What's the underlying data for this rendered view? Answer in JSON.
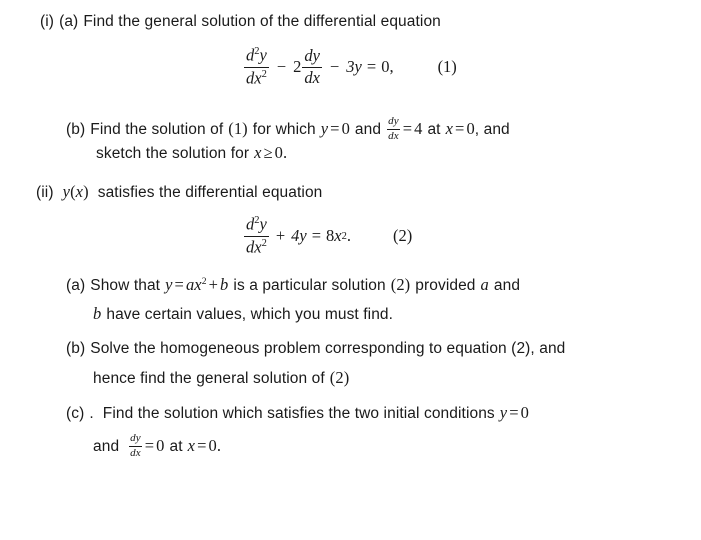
{
  "document": {
    "type": "math-exam-question",
    "background_color": "#ffffff",
    "text_color": "#1a1a1a",
    "topic": "differential equations"
  },
  "parts": {
    "i": {
      "label": "(i)",
      "a": {
        "label": "(a)",
        "text": "Find the general solution of the differential equation"
      },
      "equation1": {
        "number": "(1)",
        "numerator": "d",
        "numerator_exp": "2",
        "numerator_var": "y",
        "denominator": "dx",
        "denominator_exp": "2",
        "minus": "−",
        "coefficient": "2",
        "dy": "dy",
        "dx": "dx",
        "minus2": "−",
        "term": "3y",
        "equals": "=",
        "rhs": "0,",
        "plain": "d²y/dx² − 2 dy/dx − 3y = 0,"
      },
      "b": {
        "label": "(b)",
        "line1_pre": "Find the solution of",
        "line1_ref": "(1)",
        "line1_mid": "for which",
        "line1_y": "y",
        "line1_eq": "=",
        "line1_zero": "0",
        "line1_and": "and",
        "line1_dy": "dy",
        "line1_dx": "dx",
        "line1_eq2": "=",
        "line1_four": "4",
        "line1_at": "at",
        "line1_x": "x",
        "line1_eq3": "=",
        "line1_zero2": "0",
        "line1_tail": ", and",
        "line2_pre": "sketch the solution for",
        "line2_x": "x",
        "line2_ge": "≥",
        "line2_zero": "0",
        "line2_period": ".",
        "plain": "Find the solution of (1) for which y = 0 and dy/dx = 4 at x = 0, and sketch the solution for x ≥ 0."
      }
    },
    "ii": {
      "label": "(ii)",
      "intro_y": "y",
      "intro_paren_open": "(",
      "intro_x": "x",
      "intro_paren_close": ")",
      "intro_text": "satisfies the differential equation",
      "equation2": {
        "number": "(2)",
        "numerator": "d",
        "numerator_exp": "2",
        "numerator_var": "y",
        "denominator": "dx",
        "denominator_exp": "2",
        "plus": "+",
        "term": "4y",
        "equals": "=",
        "rhs_coeff": "8",
        "rhs_var": "x",
        "rhs_exp": "2",
        "rhs_period": ".",
        "plain": "d²y/dx² + 4y = 8x²."
      },
      "a": {
        "label": "(a)",
        "line1_pre": "Show that",
        "line1_y": "y",
        "line1_eq": "=",
        "line1_a": "a",
        "line1_x": "x",
        "line1_exp": "2",
        "line1_plus": "+",
        "line1_b": "b",
        "line1_mid": "is a particular solution",
        "line1_ref": "(2)",
        "line1_provided": "provided",
        "line1_avar": "a",
        "line1_and": "and",
        "line2_b": "b",
        "line2_text": "have certain values, which you must find.",
        "plain": "Show that y = ax² + b is a particular solution (2) provided a and b have certain values, which you must find."
      },
      "b": {
        "label": "(b)",
        "line1": "Solve the homogeneous problem corresponding to equation (2), and",
        "line2_pre": "hence find the general solution of",
        "line2_ref": "(2)",
        "plain": "Solve the homogeneous problem corresponding to equation (2), and hence find the general solution of (2)"
      },
      "c": {
        "label": "(c)",
        "stray_period": ".",
        "line1_text": "Find the solution which satisfies the two initial conditions",
        "line1_y": "y",
        "line1_eq": "=",
        "line1_zero": "0",
        "line2_and": "and",
        "line2_dy": "dy",
        "line2_dx": "dx",
        "line2_eq": "=",
        "line2_zero": "0",
        "line2_at": "at",
        "line2_x": "x",
        "line2_eq2": "=",
        "line2_zero2": "0",
        "line2_period": ".",
        "plain": "Find the solution which satisfies the two initial conditions y = 0 and dy/dx = 0 at x = 0."
      }
    }
  }
}
